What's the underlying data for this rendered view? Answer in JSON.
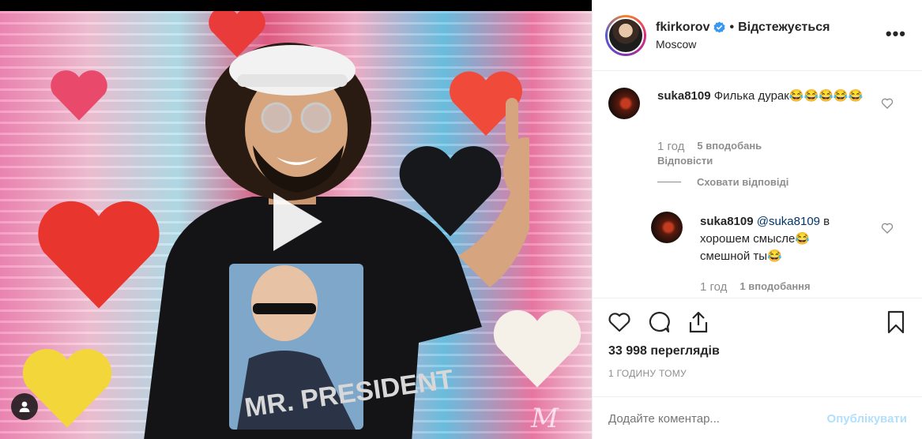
{
  "post": {
    "username": "fkirkorov",
    "follow_state": "Відстежується",
    "location": "Moscow",
    "more": "•••"
  },
  "media": {
    "shirt_text": "MR. PRESIDENT",
    "watermark": "M"
  },
  "comments": [
    {
      "username": "suka8109",
      "text": "Филька дурак😂😂😂😂😂",
      "time": "1 год",
      "likes": "5 вподобань",
      "reply": "Відповісти",
      "hide_replies": "Сховати відповіді"
    },
    {
      "username": "suka8109",
      "mention": "@suka8109",
      "text_line1": " в",
      "text_line2": "хорошем смысле😂",
      "text_line3": "смешной ты😂",
      "time": "1 год",
      "likes": "1 вподобання"
    }
  ],
  "stats": {
    "views": "33 998 переглядів",
    "ago": "1 ГОДИНУ ТОМУ"
  },
  "add_comment": {
    "placeholder": "Додайте коментар...",
    "publish": "Опублікувати"
  },
  "icons": [
    "heart-icon",
    "comment-icon",
    "share-icon",
    "bookmark-icon",
    "verified-icon",
    "play-icon",
    "user-icon"
  ]
}
